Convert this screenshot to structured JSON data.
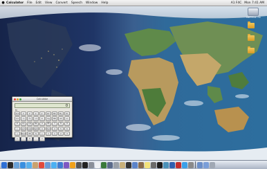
{
  "menubar": {
    "apple_icon": "apple-menu-icon",
    "app_name": "Calculator",
    "items": [
      "File",
      "Edit",
      "View",
      "Convert",
      "Speech",
      "Window",
      "Help"
    ],
    "status": [
      "A1 F4C",
      "Mon 7:41 AM"
    ]
  },
  "desktop": {
    "hd_label": "Macintosh HD",
    "folders": [
      "",
      "",
      ""
    ]
  },
  "calculator": {
    "title": "Calculator",
    "display": "0",
    "memory": "M",
    "keys": [
      "2nd",
      "x²",
      "x³",
      "xʸ",
      "eˣ",
      "10ˣ",
      "MC",
      "M+",
      "M-",
      "1/x",
      "√x",
      "∛x",
      "ʸ√x",
      "ln",
      "log",
      "MR",
      "AC",
      "+/-",
      "x!",
      "sin",
      "cos",
      "tan",
      "e",
      "EE",
      "7",
      "8",
      "9",
      "(",
      "sinh",
      "cosh",
      "tanh",
      "π",
      "Rad",
      "4",
      "5",
      "6",
      ")",
      "Rand",
      "EE",
      "%",
      "÷",
      "×",
      "1",
      "2",
      "3",
      "+",
      "-",
      "0",
      ".",
      "="
    ],
    "colors": {
      "close": "#e0443e",
      "minimize": "#dfa02b",
      "zoom": "#3aa83a"
    }
  },
  "dock": {
    "items": [
      "Finder",
      "Dashboard",
      "Mail",
      "Safari",
      "iChat",
      "Address Book",
      "iCal",
      "Preview",
      "iTunes",
      "iPhoto",
      "iMovie",
      "GarageBand",
      "Calculator",
      "Terminal",
      "System Preferences",
      "TextEdit",
      "Activity Monitor",
      "Network Utility",
      "Disk Utility",
      "Keychain",
      "Console",
      "Grapher",
      "Chess",
      "Stickies",
      "Font Book",
      "DVD Player",
      "Image Capture",
      "QuickTime",
      "Photo Booth",
      "Xcode",
      "Printer",
      "Downloads",
      "Documents",
      "Trash"
    ],
    "colors": [
      "#2e6fd4",
      "#2b2b2b",
      "#6aa2d8",
      "#3a8fe0",
      "#59b0ec",
      "#c9a26e",
      "#e24a3b",
      "#6a9bd6",
      "#4cb0f2",
      "#3f7bd1",
      "#7e57c2",
      "#f0a11b",
      "#555555",
      "#222222",
      "#8a8f99",
      "#eef0f3",
      "#3a7a3a",
      "#5a6a8a",
      "#9aa0a8",
      "#c8b07a",
      "#333333",
      "#5b83c9",
      "#8a6b4a",
      "#f3e27a",
      "#6b6b6b",
      "#1d1d1d",
      "#4a90b8",
      "#2f5fb0",
      "#c22d2d",
      "#3aa0e8",
      "#8a8a8a",
      "#6a8ec8",
      "#7a9ed8",
      "#a0a8b4"
    ]
  }
}
